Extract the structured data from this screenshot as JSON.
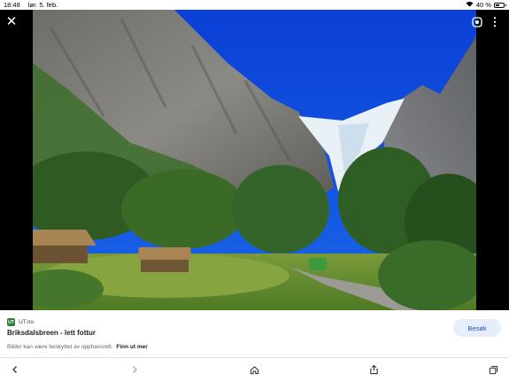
{
  "status_bar": {
    "time": "18:48",
    "date": "lør. 5. feb.",
    "battery": "40 %",
    "battery_level": 0.4
  },
  "viewer": {
    "icons": [
      "close-icon",
      "lens-icon",
      "more-vertical-icon"
    ]
  },
  "result": {
    "source": "UT.no",
    "favicon_text": "UT",
    "title": "Briksdalsbreen - lett fottur",
    "copyright_text": "Bilder kan være beskyttet av opphavsrett.",
    "learn_more": "Finn ut mer",
    "visit_button": "Besøk",
    "accent": "#1a56b8"
  },
  "toolbar": {
    "icons": [
      "back-icon",
      "forward-icon",
      "home-icon",
      "share-icon",
      "tabs-icon"
    ]
  }
}
